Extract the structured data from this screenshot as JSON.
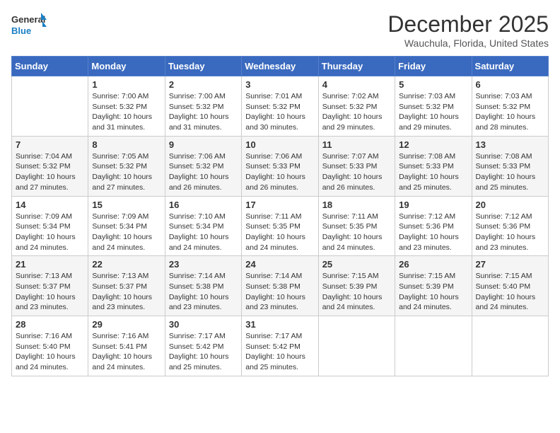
{
  "header": {
    "logo_line1": "General",
    "logo_line2": "Blue",
    "month": "December 2025",
    "location": "Wauchula, Florida, United States"
  },
  "weekdays": [
    "Sunday",
    "Monday",
    "Tuesday",
    "Wednesday",
    "Thursday",
    "Friday",
    "Saturday"
  ],
  "weeks": [
    [
      {
        "day": "",
        "info": ""
      },
      {
        "day": "1",
        "info": "Sunrise: 7:00 AM\nSunset: 5:32 PM\nDaylight: 10 hours\nand 31 minutes."
      },
      {
        "day": "2",
        "info": "Sunrise: 7:00 AM\nSunset: 5:32 PM\nDaylight: 10 hours\nand 31 minutes."
      },
      {
        "day": "3",
        "info": "Sunrise: 7:01 AM\nSunset: 5:32 PM\nDaylight: 10 hours\nand 30 minutes."
      },
      {
        "day": "4",
        "info": "Sunrise: 7:02 AM\nSunset: 5:32 PM\nDaylight: 10 hours\nand 29 minutes."
      },
      {
        "day": "5",
        "info": "Sunrise: 7:03 AM\nSunset: 5:32 PM\nDaylight: 10 hours\nand 29 minutes."
      },
      {
        "day": "6",
        "info": "Sunrise: 7:03 AM\nSunset: 5:32 PM\nDaylight: 10 hours\nand 28 minutes."
      }
    ],
    [
      {
        "day": "7",
        "info": "Sunrise: 7:04 AM\nSunset: 5:32 PM\nDaylight: 10 hours\nand 27 minutes."
      },
      {
        "day": "8",
        "info": "Sunrise: 7:05 AM\nSunset: 5:32 PM\nDaylight: 10 hours\nand 27 minutes."
      },
      {
        "day": "9",
        "info": "Sunrise: 7:06 AM\nSunset: 5:32 PM\nDaylight: 10 hours\nand 26 minutes."
      },
      {
        "day": "10",
        "info": "Sunrise: 7:06 AM\nSunset: 5:33 PM\nDaylight: 10 hours\nand 26 minutes."
      },
      {
        "day": "11",
        "info": "Sunrise: 7:07 AM\nSunset: 5:33 PM\nDaylight: 10 hours\nand 26 minutes."
      },
      {
        "day": "12",
        "info": "Sunrise: 7:08 AM\nSunset: 5:33 PM\nDaylight: 10 hours\nand 25 minutes."
      },
      {
        "day": "13",
        "info": "Sunrise: 7:08 AM\nSunset: 5:33 PM\nDaylight: 10 hours\nand 25 minutes."
      }
    ],
    [
      {
        "day": "14",
        "info": "Sunrise: 7:09 AM\nSunset: 5:34 PM\nDaylight: 10 hours\nand 24 minutes."
      },
      {
        "day": "15",
        "info": "Sunrise: 7:09 AM\nSunset: 5:34 PM\nDaylight: 10 hours\nand 24 minutes."
      },
      {
        "day": "16",
        "info": "Sunrise: 7:10 AM\nSunset: 5:34 PM\nDaylight: 10 hours\nand 24 minutes."
      },
      {
        "day": "17",
        "info": "Sunrise: 7:11 AM\nSunset: 5:35 PM\nDaylight: 10 hours\nand 24 minutes."
      },
      {
        "day": "18",
        "info": "Sunrise: 7:11 AM\nSunset: 5:35 PM\nDaylight: 10 hours\nand 24 minutes."
      },
      {
        "day": "19",
        "info": "Sunrise: 7:12 AM\nSunset: 5:36 PM\nDaylight: 10 hours\nand 23 minutes."
      },
      {
        "day": "20",
        "info": "Sunrise: 7:12 AM\nSunset: 5:36 PM\nDaylight: 10 hours\nand 23 minutes."
      }
    ],
    [
      {
        "day": "21",
        "info": "Sunrise: 7:13 AM\nSunset: 5:37 PM\nDaylight: 10 hours\nand 23 minutes."
      },
      {
        "day": "22",
        "info": "Sunrise: 7:13 AM\nSunset: 5:37 PM\nDaylight: 10 hours\nand 23 minutes."
      },
      {
        "day": "23",
        "info": "Sunrise: 7:14 AM\nSunset: 5:38 PM\nDaylight: 10 hours\nand 23 minutes."
      },
      {
        "day": "24",
        "info": "Sunrise: 7:14 AM\nSunset: 5:38 PM\nDaylight: 10 hours\nand 23 minutes."
      },
      {
        "day": "25",
        "info": "Sunrise: 7:15 AM\nSunset: 5:39 PM\nDaylight: 10 hours\nand 24 minutes."
      },
      {
        "day": "26",
        "info": "Sunrise: 7:15 AM\nSunset: 5:39 PM\nDaylight: 10 hours\nand 24 minutes."
      },
      {
        "day": "27",
        "info": "Sunrise: 7:15 AM\nSunset: 5:40 PM\nDaylight: 10 hours\nand 24 minutes."
      }
    ],
    [
      {
        "day": "28",
        "info": "Sunrise: 7:16 AM\nSunset: 5:40 PM\nDaylight: 10 hours\nand 24 minutes."
      },
      {
        "day": "29",
        "info": "Sunrise: 7:16 AM\nSunset: 5:41 PM\nDaylight: 10 hours\nand 24 minutes."
      },
      {
        "day": "30",
        "info": "Sunrise: 7:17 AM\nSunset: 5:42 PM\nDaylight: 10 hours\nand 25 minutes."
      },
      {
        "day": "31",
        "info": "Sunrise: 7:17 AM\nSunset: 5:42 PM\nDaylight: 10 hours\nand 25 minutes."
      },
      {
        "day": "",
        "info": ""
      },
      {
        "day": "",
        "info": ""
      },
      {
        "day": "",
        "info": ""
      }
    ]
  ]
}
